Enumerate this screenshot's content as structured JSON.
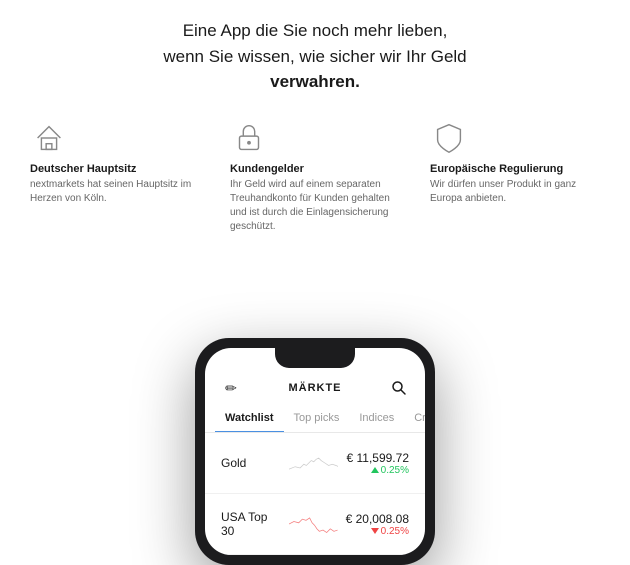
{
  "hero": {
    "line1": "Eine App die Sie noch mehr lieben,",
    "line2": "wenn Sie wissen, wie sicher wir Ihr Geld",
    "line3": "verwahren."
  },
  "features": [
    {
      "id": "headquarters",
      "icon": "house",
      "title": "Deutscher Hauptsitz",
      "desc": "nextmarkets hat seinen Hauptsitz im Herzen von Köln."
    },
    {
      "id": "customer-funds",
      "icon": "lock",
      "title": "Kundengelder",
      "desc": "Ihr Geld wird auf einem separaten Treuhandkonto für Kunden gehalten und ist durch die Einlagensicherung geschützt."
    },
    {
      "id": "eu-regulation",
      "icon": "shield",
      "title": "Europäische Regulierung",
      "desc": "Wir dürfen unser Produkt in ganz Europa anbieten."
    }
  ],
  "app": {
    "header_title": "MÄRKTE",
    "tabs": [
      {
        "label": "Watchlist",
        "active": true
      },
      {
        "label": "Top picks",
        "active": false
      },
      {
        "label": "Indices",
        "active": false
      },
      {
        "label": "Crypt",
        "active": false
      }
    ],
    "market_items": [
      {
        "name": "Gold",
        "price": "€ 11,599.72",
        "change": "0.25%",
        "direction": "positive"
      },
      {
        "name": "USA Top 30",
        "price": "€ 20,008.08",
        "change": "0.25%",
        "direction": "negative"
      }
    ]
  }
}
